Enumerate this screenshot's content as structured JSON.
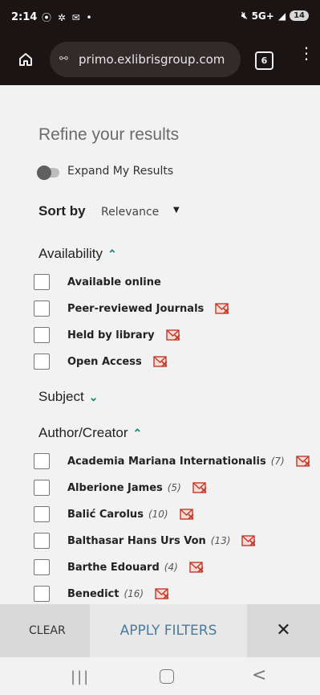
{
  "status_bar": {
    "time": "2:14",
    "left_icons": "⦿ ✲ ✉ •",
    "network": "5G+",
    "battery": "14"
  },
  "browser": {
    "url": "primo.exlibrisgroup.com",
    "tab_count": "6"
  },
  "filters": {
    "title": "Refine your results",
    "expand_label": "Expand My Results",
    "sort_label": "Sort by",
    "sort_value": "Relevance",
    "sections": {
      "availability": "Availability",
      "subject": "Subject",
      "author": "Author/Creator"
    },
    "availability_items": [
      {
        "label": "Available online"
      },
      {
        "label": "Peer-reviewed Journals"
      },
      {
        "label": "Held by library"
      },
      {
        "label": "Open Access"
      }
    ],
    "author_items": [
      {
        "label": "Academia Mariana Internationalis",
        "count": "(7)"
      },
      {
        "label": "Alberione James",
        "count": "(5)"
      },
      {
        "label": "Balić Carolus",
        "count": "(10)"
      },
      {
        "label": "Balthasar Hans Urs Von",
        "count": "(13)"
      },
      {
        "label": "Barthe Edouard",
        "count": "(4)"
      },
      {
        "label": "Benedict",
        "count": "(16)"
      }
    ]
  },
  "actions": {
    "clear": "CLEAR",
    "apply": "APPLY FILTERS",
    "close": "✕"
  },
  "colors": {
    "accent": "#0f8a7a",
    "exclude": "#c0392b",
    "apply_text": "#4a7a9c"
  },
  "icons": {
    "home": "home-icon",
    "tune": "tune-icon",
    "tabs": "tabs-icon",
    "menu": "more-vert-icon",
    "exclude": "exclude-icon"
  }
}
